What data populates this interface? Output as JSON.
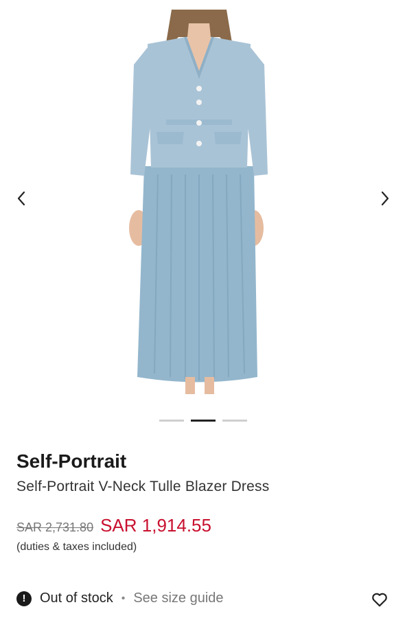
{
  "product": {
    "brand": "Self-Portrait",
    "name": "Self-Portrait V-Neck Tulle Blazer Dress",
    "old_price": "SAR 2,731.80",
    "price": "SAR 1,914.55",
    "duties_note": "(duties & taxes included)",
    "stock_status": "Out of stock",
    "separator": "•",
    "size_guide": "See size guide"
  },
  "gallery": {
    "image_count": 3,
    "active_index": 1,
    "prev_icon": "chevron-left-icon",
    "next_icon": "chevron-right-icon"
  },
  "colors": {
    "sale_red": "#c8102e",
    "jacket_blue": "#a9c3d6",
    "skirt_blue": "#93b6cc"
  }
}
